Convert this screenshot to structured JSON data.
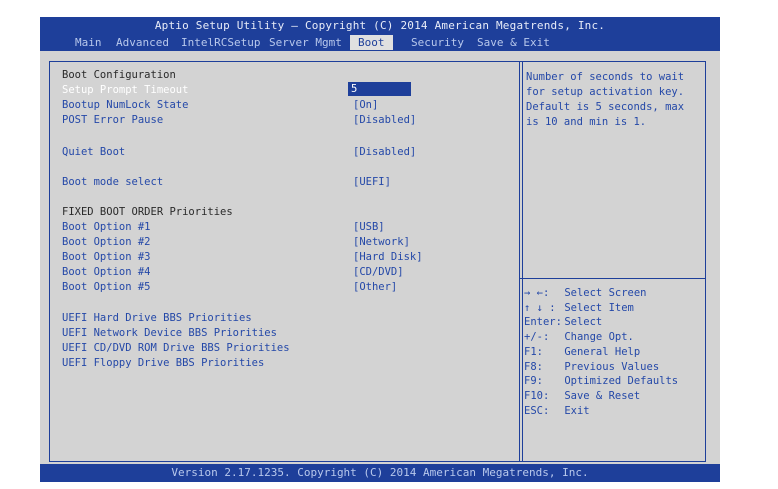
{
  "title": "Aptio Setup Utility – Copyright (C) 2014 American Megatrends, Inc.",
  "menu": {
    "main": "Main",
    "advanced": "Advanced",
    "intelrc": "IntelRCSetup",
    "server": "Server Mgmt",
    "boot": "Boot",
    "security": "Security",
    "save_exit": "Save & Exit"
  },
  "boot": {
    "section_title": "Boot Configuration",
    "setup_prompt_timeout": {
      "label": "Setup Prompt Timeout",
      "value": "5"
    },
    "numlock": {
      "label": "Bootup NumLock State",
      "value": "[On]"
    },
    "post_error": {
      "label": "POST Error Pause",
      "value": "[Disabled]"
    },
    "quiet_boot": {
      "label": "Quiet Boot",
      "value": "[Disabled]"
    },
    "boot_mode": {
      "label": "Boot mode select",
      "value": "[UEFI]"
    },
    "fixed_order_title": "FIXED BOOT ORDER Priorities",
    "options": [
      {
        "label": "Boot Option #1",
        "value": "[USB]"
      },
      {
        "label": "Boot Option #2",
        "value": "[Network]"
      },
      {
        "label": "Boot Option #3",
        "value": "[Hard Disk]"
      },
      {
        "label": "Boot Option #4",
        "value": "[CD/DVD]"
      },
      {
        "label": "Boot Option #5",
        "value": "[Other]"
      }
    ],
    "bbs": [
      "UEFI Hard Drive BBS Priorities",
      "UEFI Network Device BBS Priorities",
      "UEFI CD/DVD ROM Drive BBS Priorities",
      "UEFI Floppy Drive BBS Priorities"
    ]
  },
  "help": {
    "lines": [
      "Number of seconds to wait",
      "for setup activation key.",
      "Default is 5 seconds, max",
      "is 10 and min is 1."
    ]
  },
  "keys": [
    {
      "key": "→ ←:",
      "action": "Select Screen"
    },
    {
      "key": "↑ ↓ :",
      "action": "Select Item"
    },
    {
      "key": "Enter:",
      "action": "Select"
    },
    {
      "key": "+/-:",
      "action": "Change Opt."
    },
    {
      "key": "F1:",
      "action": "General Help"
    },
    {
      "key": "F8:",
      "action": "Previous Values"
    },
    {
      "key": "F9:",
      "action": "Optimized Defaults"
    },
    {
      "key": "F10:",
      "action": "Save & Reset"
    },
    {
      "key": "ESC:",
      "action": "Exit"
    }
  ],
  "footer": "Version 2.17.1235. Copyright (C) 2014 American Megatrends, Inc.",
  "colors": {
    "accent": "#1e3f9a",
    "background": "#d3d3d3",
    "text": "#2448a8"
  }
}
